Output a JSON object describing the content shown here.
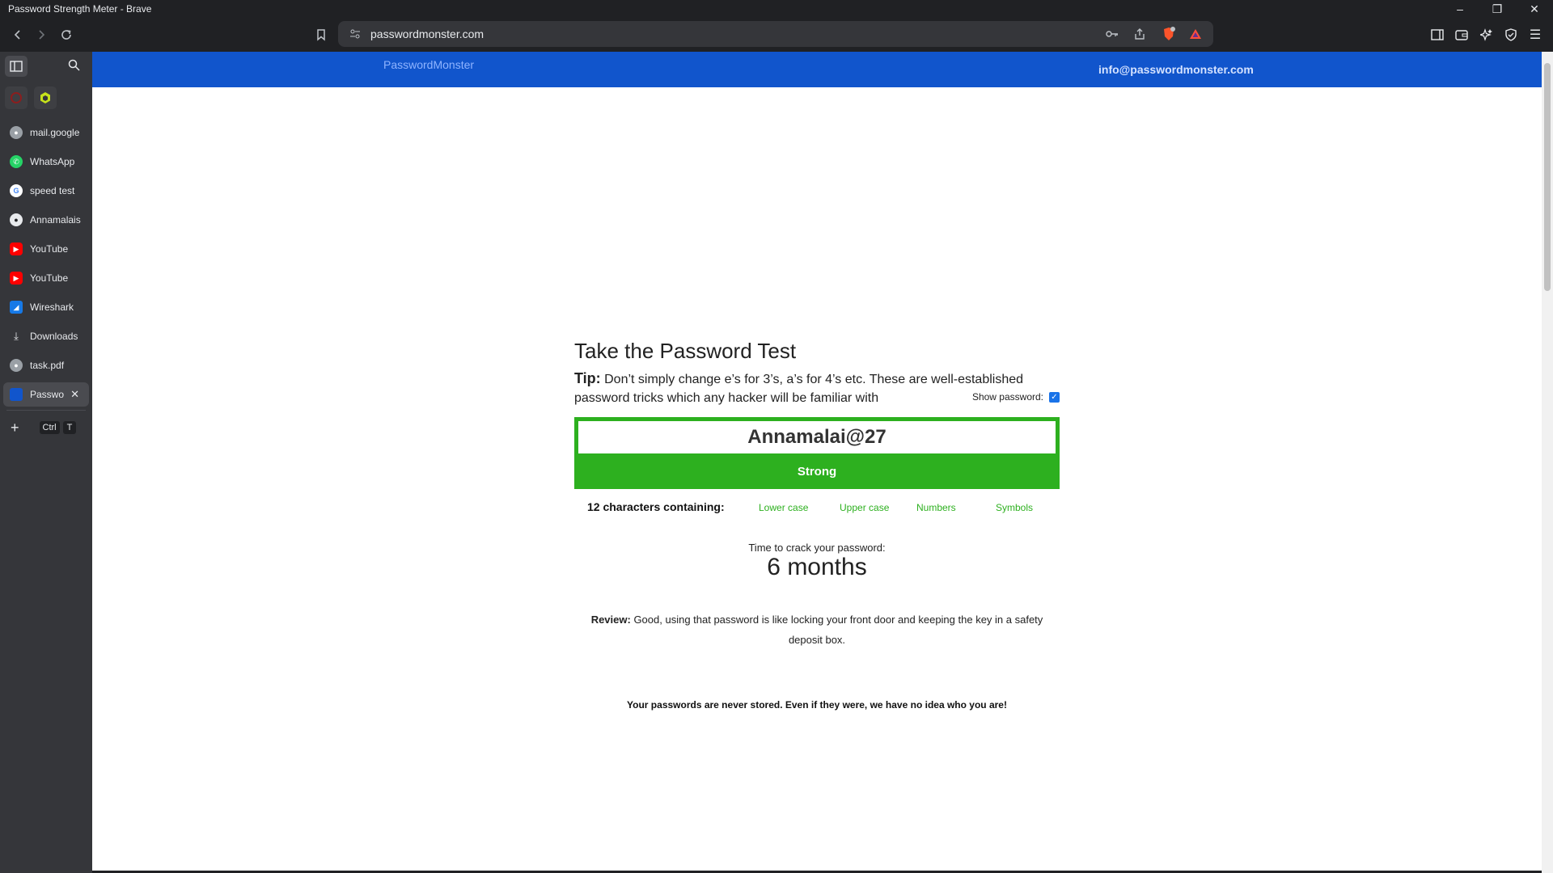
{
  "window": {
    "title": "Password Strength Meter - Brave",
    "minimize": "–",
    "restore": "❐",
    "close": "✕"
  },
  "toolbar": {
    "url": "passwordmonster.com",
    "back_icon": "‹",
    "forward_icon": "›",
    "reload_icon": "↻",
    "bookmark_icon": "☐",
    "menu_icon": "☰"
  },
  "sidebar": {
    "items": [
      {
        "label": "mail.google",
        "icon": "globe-icon",
        "color": "#9aa0a6"
      },
      {
        "label": "WhatsApp",
        "icon": "whatsapp-icon",
        "color": "#25d366"
      },
      {
        "label": "speed test",
        "icon": "google-icon",
        "color": "#4285f4"
      },
      {
        "label": "Annamalais",
        "icon": "github-icon",
        "color": "#e8eaed"
      },
      {
        "label": "YouTube",
        "icon": "youtube-icon",
        "color": "#ff0000"
      },
      {
        "label": "YouTube",
        "icon": "youtube-icon",
        "color": "#ff0000"
      },
      {
        "label": "Wireshark",
        "icon": "wireshark-icon",
        "color": "#1679e7"
      },
      {
        "label": "Downloads",
        "icon": "download-icon",
        "color": "#e8eaed"
      },
      {
        "label": "task.pdf",
        "icon": "globe-icon",
        "color": "#9aa0a6"
      },
      {
        "label": "Passwo",
        "icon": "passwordmonster-icon",
        "color": "#1155cc"
      }
    ],
    "new_tab_plus": "+",
    "shortcut_ctrl": "Ctrl",
    "shortcut_t": "T",
    "close_tab": "✕"
  },
  "site": {
    "logo_alt": "PasswordMonster",
    "email": "info@passwordmonster.com"
  },
  "test": {
    "title": "Take the Password Test",
    "tip_label": "Tip:",
    "tip_text": " Don’t simply change e’s for 3’s, a’s for 4’s etc. These are well-established password tricks which any hacker will be familiar with",
    "show_password_label": "Show password:",
    "show_password_checked": true,
    "password_value": "Annamalai@27",
    "strength": "Strong",
    "strength_color": "#2db01f",
    "characters": "12 characters containing:",
    "criteria": [
      "Lower case",
      "Upper case",
      "Numbers",
      "Symbols"
    ],
    "crack_label": "Time to crack your password:",
    "crack_time": "6 months",
    "review_label": "Review:",
    "review_text": " Good, using that password is like locking your front door and keeping the key in a safety deposit box.",
    "stored_note": "Your passwords are never stored. Even if they were, we have no idea who you are!"
  },
  "colors": {
    "header_blue": "#1155cc",
    "sidebar_bg": "#35363a",
    "strong_green": "#2db01f"
  }
}
